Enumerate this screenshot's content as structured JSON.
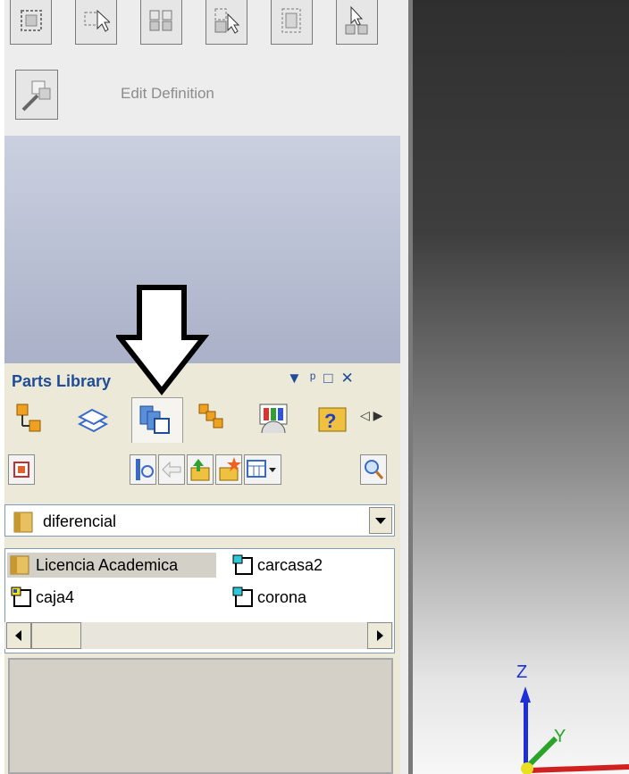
{
  "toolbar": {
    "edit_definition_label": "Edit Definition",
    "buttons": [
      "part-icon",
      "select-part-icon",
      "pattern-icon",
      "select-edge-icon",
      "box-part-icon",
      "drag-part-icon"
    ]
  },
  "parts_library": {
    "title": "Parts Library",
    "window_controls": "▼ ┃ □ ✕",
    "path": "diferencial",
    "items": [
      {
        "name": "Licencia Academica",
        "type": "folder"
      },
      {
        "name": "carcasa2",
        "type": "part"
      },
      {
        "name": "caja4",
        "type": "assembly"
      },
      {
        "name": "corona",
        "type": "part"
      }
    ]
  },
  "viewport": {
    "axis_z": "Z",
    "axis_y": "Y"
  },
  "colors": {
    "panel_title": "#1f4c96",
    "axis_blue": "#1f2fd8",
    "axis_green": "#2aa52a"
  }
}
